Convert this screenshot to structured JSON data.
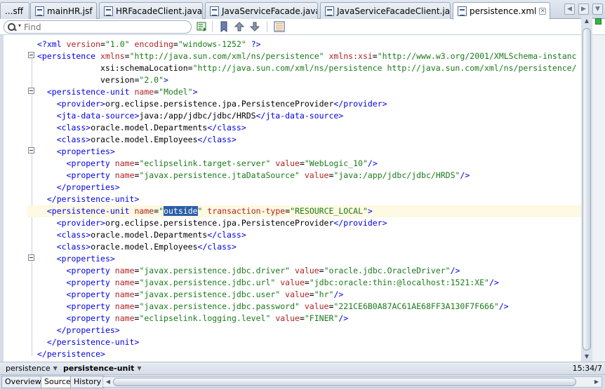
{
  "tabs": [
    {
      "label": "...sff",
      "active": false
    },
    {
      "label": "mainHR.jsf",
      "active": false
    },
    {
      "label": "HRFacadeClient.java",
      "active": false
    },
    {
      "label": "JavaServiceFacade.java",
      "active": false
    },
    {
      "label": "JavaServiceFacadeClient.java",
      "active": false
    },
    {
      "label": "persistence.xml",
      "active": true
    }
  ],
  "find": {
    "placeholder": "Find",
    "value": ""
  },
  "code_lines": [
    "<?xml version=\"1.0\" encoding=\"windows-1252\" ?>",
    "<persistence xmlns=\"http://java.sun.com/xml/ns/persistence\" xmlns:xsi=\"http://www.w3.org/2001/XMLSchema-instanc",
    "             xsi:schemaLocation=\"http://java.sun.com/xml/ns/persistence http://java.sun.com/xml/ns/persistence/",
    "             version=\"2.0\">",
    "  <persistence-unit name=\"Model\">",
    "    <provider>org.eclipse.persistence.jpa.PersistenceProvider</provider>",
    "    <jta-data-source>java:/app/jdbc/jdbc/HRDS</jta-data-source>",
    "    <class>oracle.model.Departments</class>",
    "    <class>oracle.model.Employees</class>",
    "    <properties>",
    "      <property name=\"eclipselink.target-server\" value=\"WebLogic_10\"/>",
    "      <property name=\"javax.persistence.jtaDataSource\" value=\"java:/app/jdbc/jdbc/HRDS\"/>",
    "    </properties>",
    "  </persistence-unit>",
    "  <persistence-unit name=\"outside\" transaction-type=\"RESOURCE_LOCAL\">",
    "    <provider>org.eclipse.persistence.jpa.PersistenceProvider</provider>",
    "    <class>oracle.model.Departments</class>",
    "    <class>oracle.model.Employees</class>",
    "    <properties>",
    "      <property name=\"javax.persistence.jdbc.driver\" value=\"oracle.jdbc.OracleDriver\"/>",
    "      <property name=\"javax.persistence.jdbc.url\" value=\"jdbc:oracle:thin:@localhost:1521:XE\"/>",
    "      <property name=\"javax.persistence.jdbc.user\" value=\"hr\"/>",
    "      <property name=\"javax.persistence.jdbc.password\" value=\"221CE6B0A87AC61AE68FF3A130F7F666\"/>",
    "      <property name=\"eclipselink.logging.level\" value=\"FINER\"/>",
    "    </properties>",
    "  </persistence-unit>",
    "</persistence>"
  ],
  "current_line": 15,
  "selection": {
    "line": 15,
    "text": "outside"
  },
  "fold_lines": [
    2,
    5,
    10,
    15,
    19
  ],
  "breadcrumb": {
    "items": [
      "persistence",
      "persistence-unit"
    ]
  },
  "cursor_position": "15:34/7",
  "bottom_tabs": [
    {
      "label": "Overview",
      "active": false
    },
    {
      "label": "Source",
      "active": true
    },
    {
      "label": "History",
      "active": false
    }
  ],
  "colors": {
    "tag": "#0000e6",
    "attribute": "#b22222",
    "value": "#1a7a1a",
    "selection": "#2a5ea8",
    "current_line": "#fdf9e2"
  }
}
